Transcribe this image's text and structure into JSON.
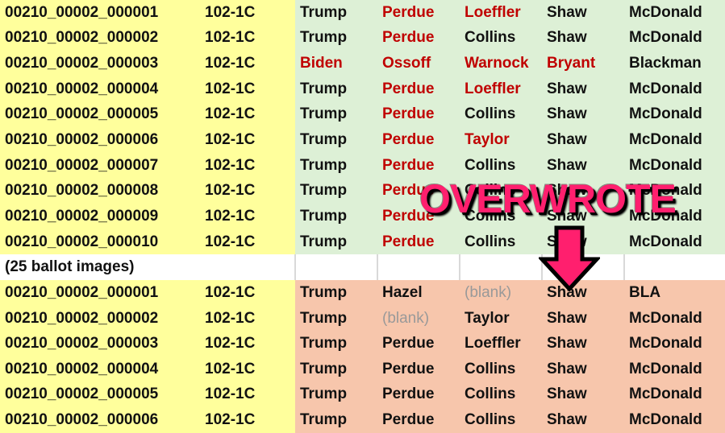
{
  "colors": {
    "source_fill": "#FFFF9C",
    "top_fill": "#DDF0D6",
    "bottom_fill": "#F7C6AC",
    "red_text": "#C00000",
    "annotation": "#FF1F6E"
  },
  "top_rows": [
    {
      "id": "00210_00002_000001",
      "batch": "102-1C",
      "votes": [
        {
          "t": "Trump",
          "s": "n"
        },
        {
          "t": "Perdue",
          "s": "r"
        },
        {
          "t": "Loeffler",
          "s": "r"
        },
        {
          "t": "Shaw",
          "s": "n"
        },
        {
          "t": "McDonald",
          "s": "n"
        }
      ]
    },
    {
      "id": "00210_00002_000002",
      "batch": "102-1C",
      "votes": [
        {
          "t": "Trump",
          "s": "n"
        },
        {
          "t": "Perdue",
          "s": "r"
        },
        {
          "t": "Collins",
          "s": "n"
        },
        {
          "t": "Shaw",
          "s": "n"
        },
        {
          "t": "McDonald",
          "s": "n"
        }
      ]
    },
    {
      "id": "00210_00002_000003",
      "batch": "102-1C",
      "votes": [
        {
          "t": "Biden",
          "s": "r"
        },
        {
          "t": "Ossoff",
          "s": "r"
        },
        {
          "t": "Warnock",
          "s": "r"
        },
        {
          "t": "Bryant",
          "s": "r"
        },
        {
          "t": "Blackman",
          "s": "n"
        }
      ]
    },
    {
      "id": "00210_00002_000004",
      "batch": "102-1C",
      "votes": [
        {
          "t": "Trump",
          "s": "n"
        },
        {
          "t": "Perdue",
          "s": "r"
        },
        {
          "t": "Loeffler",
          "s": "r"
        },
        {
          "t": "Shaw",
          "s": "n"
        },
        {
          "t": "McDonald",
          "s": "n"
        }
      ]
    },
    {
      "id": "00210_00002_000005",
      "batch": "102-1C",
      "votes": [
        {
          "t": "Trump",
          "s": "n"
        },
        {
          "t": "Perdue",
          "s": "r"
        },
        {
          "t": "Collins",
          "s": "n"
        },
        {
          "t": "Shaw",
          "s": "n"
        },
        {
          "t": "McDonald",
          "s": "n"
        }
      ]
    },
    {
      "id": "00210_00002_000006",
      "batch": "102-1C",
      "votes": [
        {
          "t": "Trump",
          "s": "n"
        },
        {
          "t": "Perdue",
          "s": "r"
        },
        {
          "t": "Taylor",
          "s": "r"
        },
        {
          "t": "Shaw",
          "s": "n"
        },
        {
          "t": "McDonald",
          "s": "n"
        }
      ]
    },
    {
      "id": "00210_00002_000007",
      "batch": "102-1C",
      "votes": [
        {
          "t": "Trump",
          "s": "n"
        },
        {
          "t": "Perdue",
          "s": "r"
        },
        {
          "t": "Collins",
          "s": "n"
        },
        {
          "t": "Shaw",
          "s": "n"
        },
        {
          "t": "McDonald",
          "s": "n"
        }
      ]
    },
    {
      "id": "00210_00002_000008",
      "batch": "102-1C",
      "votes": [
        {
          "t": "Trump",
          "s": "n"
        },
        {
          "t": "Perdue",
          "s": "r"
        },
        {
          "t": "Collins",
          "s": "n"
        },
        {
          "t": "Shaw",
          "s": "n"
        },
        {
          "t": "McDonald",
          "s": "n"
        }
      ]
    },
    {
      "id": "00210_00002_000009",
      "batch": "102-1C",
      "votes": [
        {
          "t": "Trump",
          "s": "n"
        },
        {
          "t": "Perdue",
          "s": "r"
        },
        {
          "t": "Collins",
          "s": "n"
        },
        {
          "t": "Shaw",
          "s": "n"
        },
        {
          "t": "McDonald",
          "s": "n"
        }
      ]
    },
    {
      "id": "00210_00002_000010",
      "batch": "102-1C",
      "votes": [
        {
          "t": "Trump",
          "s": "n"
        },
        {
          "t": "Perdue",
          "s": "r"
        },
        {
          "t": "Collins",
          "s": "n"
        },
        {
          "t": "Shaw",
          "s": "n"
        },
        {
          "t": "McDonald",
          "s": "n"
        }
      ]
    }
  ],
  "spacer_label": "(25 ballot images)",
  "bottom_rows": [
    {
      "id": "00210_00002_000001",
      "batch": "102-1C",
      "votes": [
        {
          "t": "Trump",
          "s": "n"
        },
        {
          "t": "Hazel",
          "s": "n"
        },
        {
          "t": "(blank)",
          "s": "b"
        },
        {
          "t": "Shaw",
          "s": "n"
        },
        {
          "t": "BLA",
          "s": "n"
        }
      ]
    },
    {
      "id": "00210_00002_000002",
      "batch": "102-1C",
      "votes": [
        {
          "t": "Trump",
          "s": "n"
        },
        {
          "t": "(blank)",
          "s": "b"
        },
        {
          "t": "Taylor",
          "s": "n"
        },
        {
          "t": "Shaw",
          "s": "n"
        },
        {
          "t": "McDonald",
          "s": "n"
        }
      ]
    },
    {
      "id": "00210_00002_000003",
      "batch": "102-1C",
      "votes": [
        {
          "t": "Trump",
          "s": "n"
        },
        {
          "t": "Perdue",
          "s": "n"
        },
        {
          "t": "Loeffler",
          "s": "n"
        },
        {
          "t": "Shaw",
          "s": "n"
        },
        {
          "t": "McDonald",
          "s": "n"
        }
      ]
    },
    {
      "id": "00210_00002_000004",
      "batch": "102-1C",
      "votes": [
        {
          "t": "Trump",
          "s": "n"
        },
        {
          "t": "Perdue",
          "s": "n"
        },
        {
          "t": "Collins",
          "s": "n"
        },
        {
          "t": "Shaw",
          "s": "n"
        },
        {
          "t": "McDonald",
          "s": "n"
        }
      ]
    },
    {
      "id": "00210_00002_000005",
      "batch": "102-1C",
      "votes": [
        {
          "t": "Trump",
          "s": "n"
        },
        {
          "t": "Perdue",
          "s": "n"
        },
        {
          "t": "Collins",
          "s": "n"
        },
        {
          "t": "Shaw",
          "s": "n"
        },
        {
          "t": "McDonald",
          "s": "n"
        }
      ]
    },
    {
      "id": "00210_00002_000006",
      "batch": "102-1C",
      "votes": [
        {
          "t": "Trump",
          "s": "n"
        },
        {
          "t": "Perdue",
          "s": "n"
        },
        {
          "t": "Collins",
          "s": "n"
        },
        {
          "t": "Shaw",
          "s": "n"
        },
        {
          "t": "McDonald",
          "s": "n"
        }
      ]
    }
  ],
  "annotation": {
    "label": "OVERWROTE",
    "icon": "down-arrow-icon"
  }
}
